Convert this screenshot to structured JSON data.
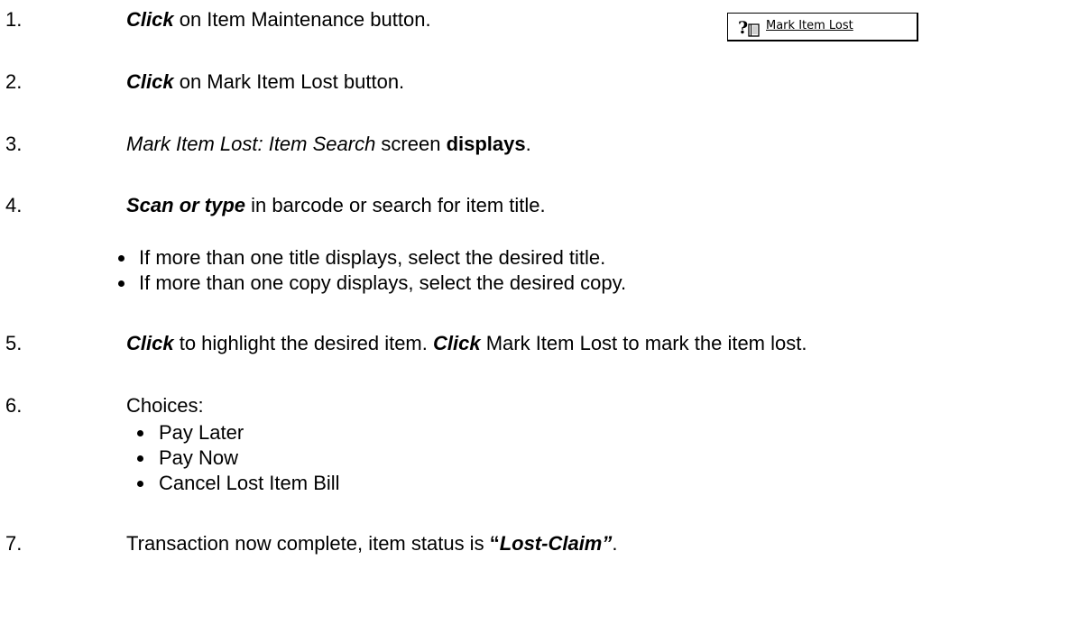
{
  "steps": [
    {
      "num": "1.",
      "parts": [
        {
          "t": "Click",
          "s": "bi"
        },
        {
          "t": " on Item Maintenance button.",
          "s": ""
        }
      ]
    },
    {
      "num": "2.",
      "parts": [
        {
          "t": "Click",
          "s": "bi"
        },
        {
          "t": " on Mark Item Lost button.",
          "s": ""
        }
      ]
    },
    {
      "num": "3.",
      "parts": [
        {
          "t": "Mark Item Lost: Item Search",
          "s": "it"
        },
        {
          "t": " screen ",
          "s": ""
        },
        {
          "t": "displays",
          "s": "bd"
        },
        {
          "t": ".",
          "s": ""
        }
      ]
    },
    {
      "num": "4.",
      "parts": [
        {
          "t": "Scan or type",
          "s": "bi"
        },
        {
          "t": " in barcode or search for item title.",
          "s": ""
        }
      ]
    },
    {
      "num": "5.",
      "parts": [
        {
          "t": "Click",
          "s": "bi"
        },
        {
          "t": " to highlight the desired item. ",
          "s": ""
        },
        {
          "t": "Click",
          "s": "bi"
        },
        {
          "t": " Mark Item Lost to mark the item lost.",
          "s": ""
        }
      ]
    },
    {
      "num": "6.",
      "parts": [
        {
          "t": "Choices:",
          "s": ""
        }
      ]
    },
    {
      "num": "7.",
      "parts": [
        {
          "t": "Transaction now complete, item status is ",
          "s": ""
        },
        {
          "t": "“",
          "s": "bd"
        },
        {
          "t": "Lost-Claim”",
          "s": "bi"
        },
        {
          "t": ".",
          "s": ""
        }
      ]
    }
  ],
  "step4_bullets": [
    "If more than one title displays, select the desired title.",
    "If more than one copy displays, select the desired copy."
  ],
  "step6_choices": [
    "Pay Later",
    "Pay Now",
    "Cancel Lost Item Bill"
  ],
  "mark_item_lost_button": {
    "label": "Mark Item Lost",
    "icon": "question-book-icon"
  }
}
